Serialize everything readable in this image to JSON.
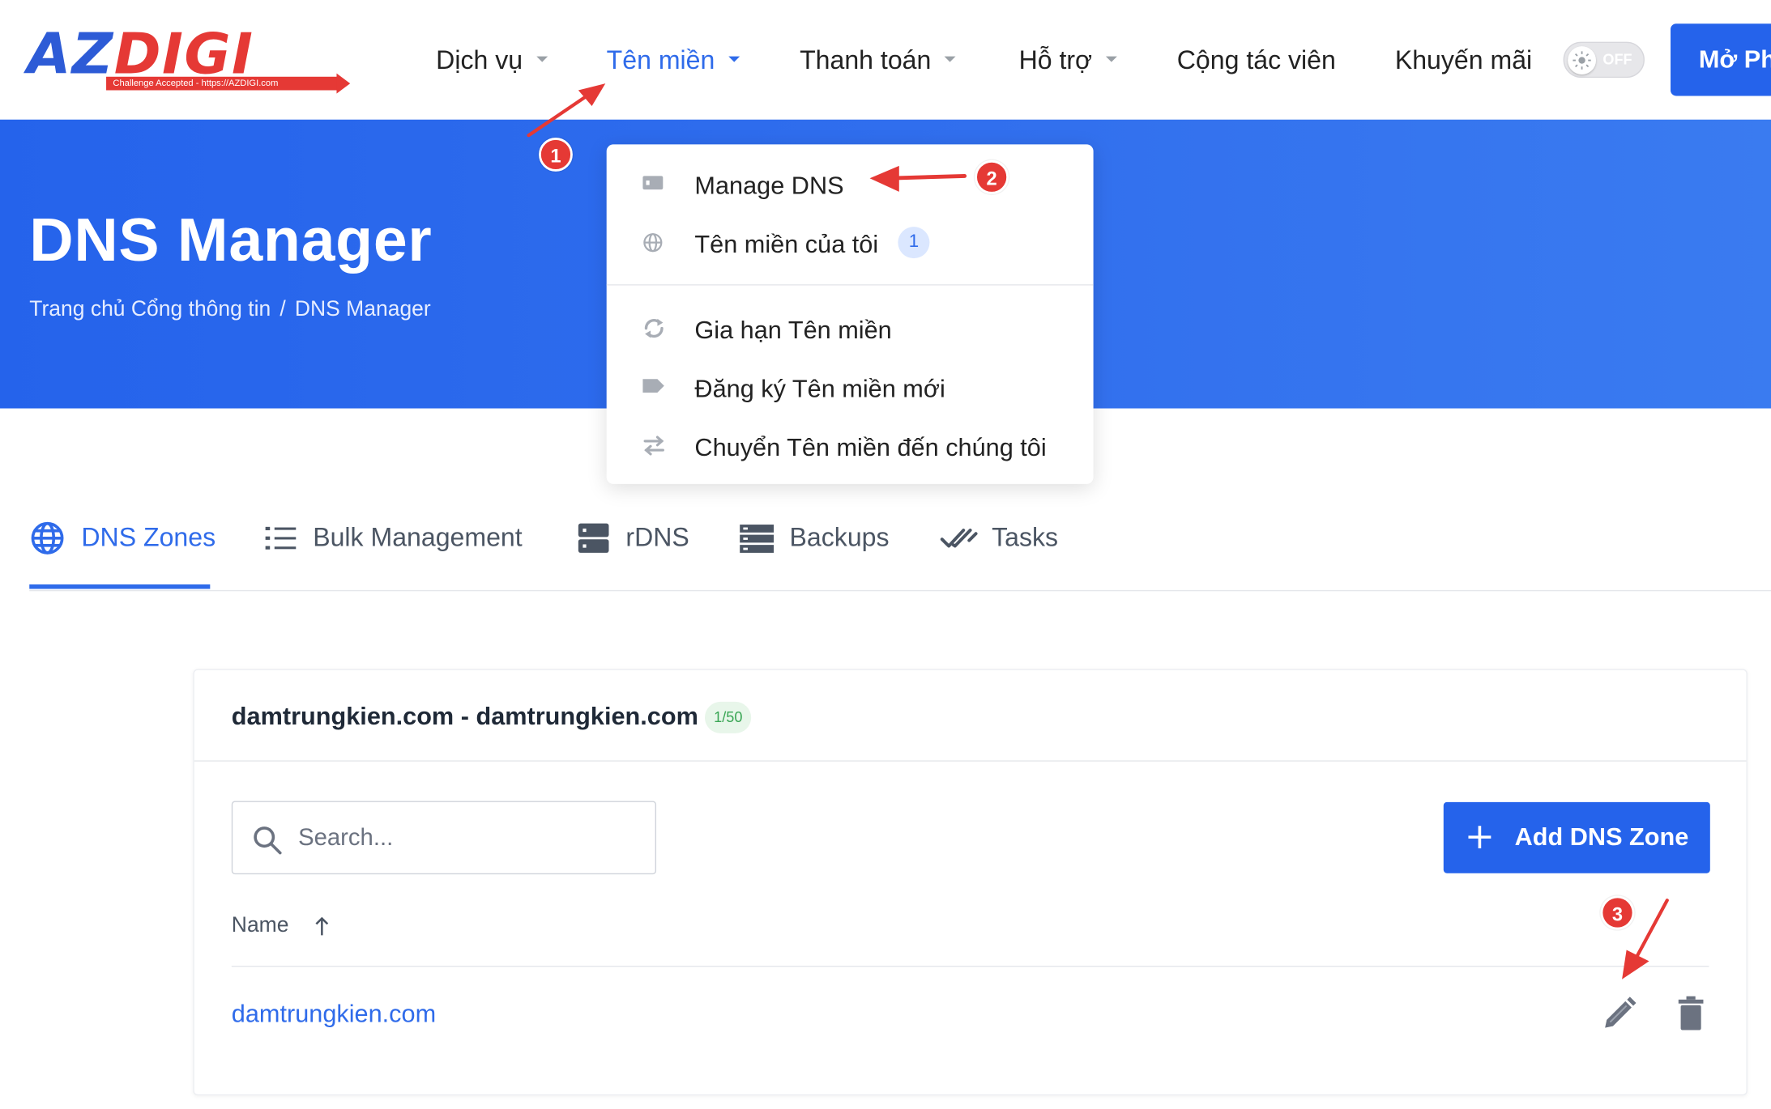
{
  "brand": {
    "logo_part1": "AZ",
    "logo_part2": "DIGI",
    "tagline": "Challenge Accepted - https://AZDIGI.com",
    "primary_color": "#2563eb",
    "accent_color": "#e53935"
  },
  "nav": {
    "items": [
      {
        "label": "Dịch vụ",
        "has_caret": true
      },
      {
        "label": "Tên miền",
        "has_caret": true,
        "active": true
      },
      {
        "label": "Thanh toán",
        "has_caret": true
      },
      {
        "label": "Hỗ trợ",
        "has_caret": true
      },
      {
        "label": "Cộng tác viên",
        "has_caret": false
      },
      {
        "label": "Khuyến mãi",
        "has_caret": false
      }
    ],
    "theme_toggle_label": "OFF",
    "cta_label": "Mở Ph"
  },
  "hero": {
    "title": "DNS Manager",
    "breadcrumb": [
      "Trang chủ Cổng thông tin",
      "DNS Manager"
    ],
    "breadcrumb_sep": "/"
  },
  "dropdown": {
    "items": [
      {
        "label": "Manage DNS",
        "icon": "dns-card-icon"
      },
      {
        "label": "Tên miền của tôi",
        "icon": "globe-icon",
        "badge": "1"
      },
      {
        "label": "Gia hạn Tên miền",
        "icon": "sync-icon"
      },
      {
        "label": "Đăng ký Tên miền mới",
        "icon": "tag-icon"
      },
      {
        "label": "Chuyển Tên miền đến chúng tôi",
        "icon": "transfer-icon"
      }
    ]
  },
  "tabs": [
    {
      "label": "DNS Zones",
      "icon": "globe-icon",
      "active": true
    },
    {
      "label": "Bulk Management",
      "icon": "list-icon"
    },
    {
      "label": "rDNS",
      "icon": "server-icon"
    },
    {
      "label": "Backups",
      "icon": "backups-icon"
    },
    {
      "label": "Tasks",
      "icon": "double-check-icon"
    }
  ],
  "card": {
    "title": "damtrungkien.com - damtrungkien.com",
    "count_badge": "1/50",
    "search_placeholder": "Search...",
    "add_button_label": "Add DNS Zone",
    "column_name": "Name",
    "zones": [
      {
        "name": "damtrungkien.com"
      }
    ]
  },
  "annotations": {
    "steps": [
      "1",
      "2",
      "3"
    ],
    "color": "#e53935"
  }
}
